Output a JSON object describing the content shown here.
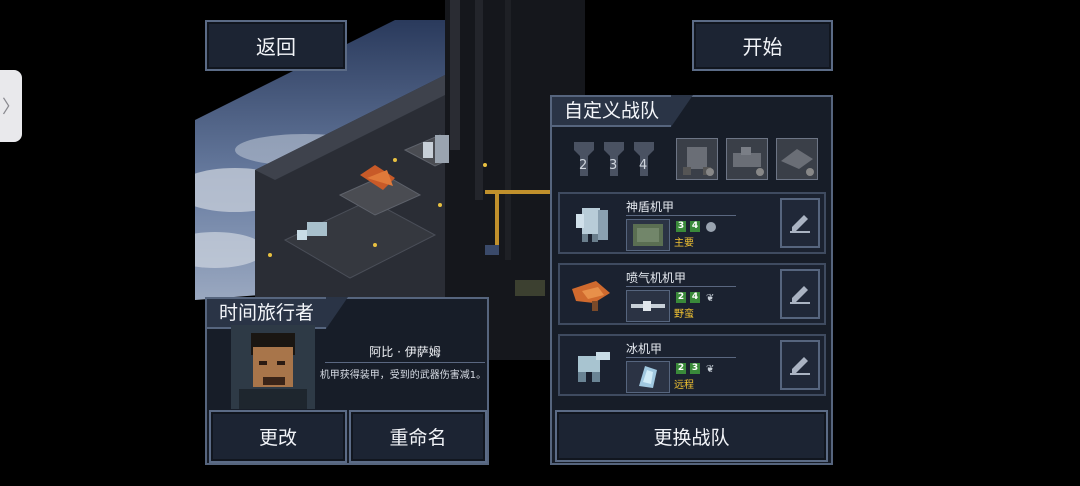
{
  "top_buttons": {
    "back": "返回",
    "start": "开始"
  },
  "pilot_panel": {
    "title": "时间旅行者",
    "pilot_name": "阿比 · 伊萨姆",
    "ability": "机甲获得装甲，受到的武器伤害减1。",
    "change": "更改",
    "rename": "重命名"
  },
  "squad_panel": {
    "title": "自定义战队",
    "pilot_slots": [
      "2",
      "3",
      "4"
    ],
    "mechs": [
      {
        "name": "神盾机甲",
        "stats": [
          "3",
          "4"
        ],
        "tag": "主要"
      },
      {
        "name": "喷气机机甲",
        "stats": [
          "2",
          "4"
        ],
        "tag": "野蛮"
      },
      {
        "name": "冰机甲",
        "stats": [
          "2",
          "3"
        ],
        "tag": "远程"
      }
    ],
    "change_squad": "更换战队"
  },
  "colors": {
    "accent_tag": "#f1c232",
    "stat_green": "#3a8a3a",
    "panel_border": "#56657e"
  }
}
